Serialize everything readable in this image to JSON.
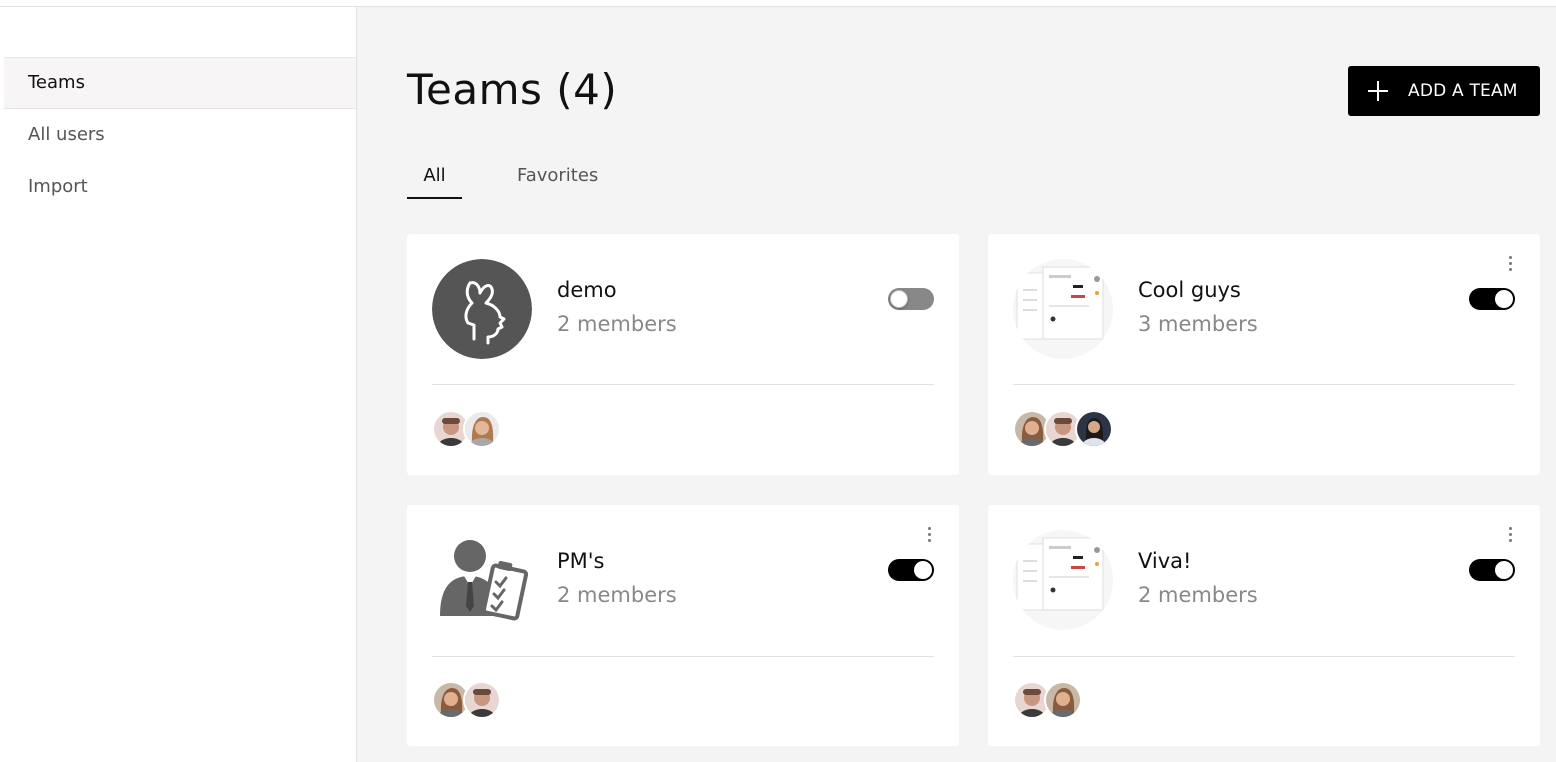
{
  "sidebar": {
    "items": [
      {
        "label": "Teams",
        "active": true
      },
      {
        "label": "All users",
        "active": false
      },
      {
        "label": "Import",
        "active": false
      }
    ]
  },
  "header": {
    "title": "Teams (4)",
    "add_button_label": "ADD A TEAM",
    "add_button_icon": "plus-icon"
  },
  "tabs": [
    {
      "label": "All",
      "active": true
    },
    {
      "label": "Favorites",
      "active": false
    }
  ],
  "teams": [
    {
      "name": "demo",
      "members": "2 members",
      "toggle_on": false,
      "logo": "bunny-head-icon",
      "has_menu": false,
      "avatar_count": 2
    },
    {
      "name": "Cool guys",
      "members": "3 members",
      "toggle_on": true,
      "logo": "screenshot-thumbnail",
      "has_menu": true,
      "avatar_count": 3
    },
    {
      "name": "PM's",
      "members": "2 members",
      "toggle_on": true,
      "logo": "manager-checklist-icon",
      "has_menu": true,
      "avatar_count": 2
    },
    {
      "name": "Viva!",
      "members": "2 members",
      "toggle_on": true,
      "logo": "screenshot-thumbnail",
      "has_menu": true,
      "avatar_count": 2
    }
  ],
  "colors": {
    "accent": "#000000",
    "background": "#f4f4f4",
    "muted_text": "#888888"
  }
}
